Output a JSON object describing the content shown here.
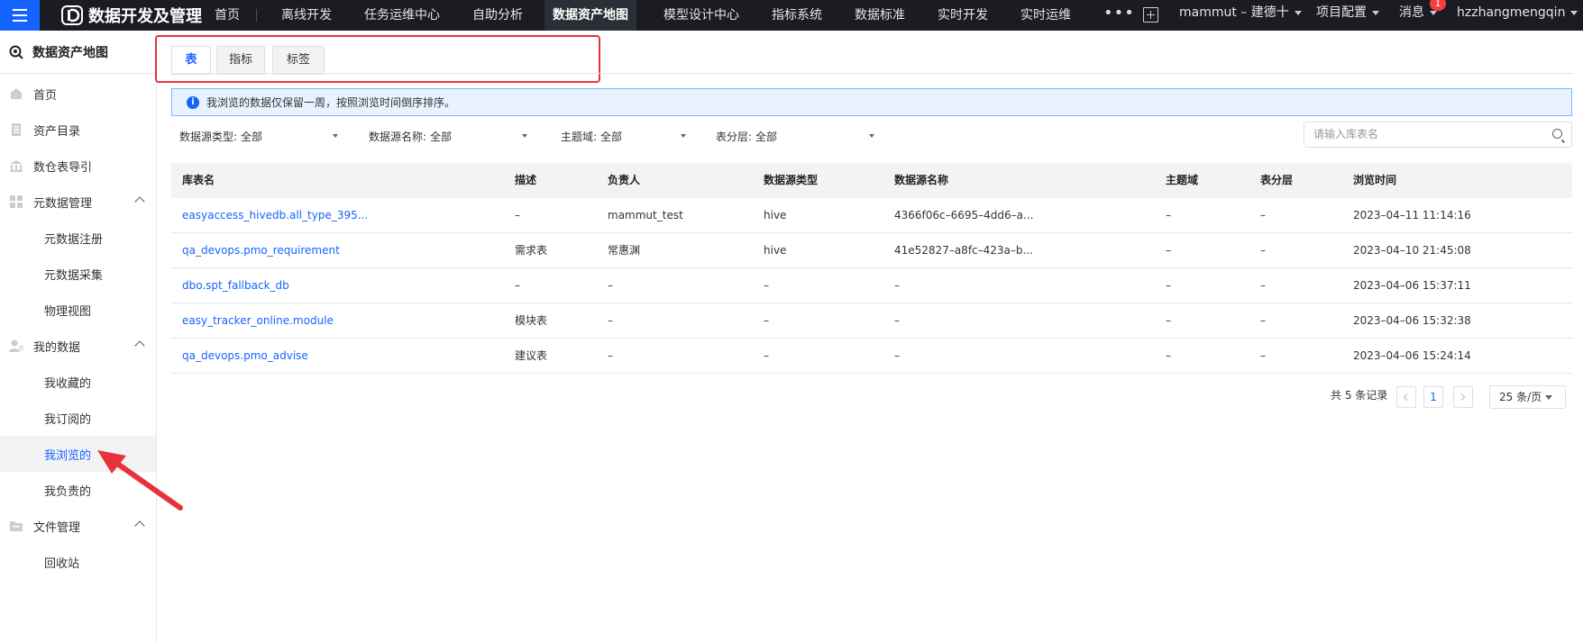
{
  "topbar": {
    "brand": "数据开发及管理",
    "nav": [
      "首页",
      "离线开发",
      "任务运维中心",
      "自助分析",
      "数据资产地图",
      "模型设计中心",
      "指标系统",
      "数据标准",
      "实时开发",
      "实时运维"
    ],
    "more": "•••",
    "project": "mammut – 建德十",
    "config": "项目配置",
    "messages": "消息",
    "message_count": "1",
    "user": "hzzhangmengqin"
  },
  "sidebar": {
    "title": "数据资产地图",
    "items": [
      {
        "label": "首页"
      },
      {
        "label": "资产目录"
      },
      {
        "label": "数仓表导引"
      },
      {
        "label": "元数据管理"
      },
      {
        "label": "元数据注册"
      },
      {
        "label": "元数据采集"
      },
      {
        "label": "物理视图"
      },
      {
        "label": "我的数据"
      },
      {
        "label": "我收藏的"
      },
      {
        "label": "我订阅的"
      },
      {
        "label": "我浏览的"
      },
      {
        "label": "我负责的"
      },
      {
        "label": "文件管理"
      },
      {
        "label": "回收站"
      }
    ]
  },
  "tabs": [
    "表",
    "指标",
    "标签"
  ],
  "info": "我浏览的数据仅保留一周，按照浏览时间倒序排序。",
  "filters": [
    {
      "label": "数据源类型:",
      "value": "全部"
    },
    {
      "label": "数据源名称:",
      "value": "全部"
    },
    {
      "label": "主题域:",
      "value": "全部"
    },
    {
      "label": "表分层:",
      "value": "全部"
    }
  ],
  "search": {
    "placeholder": "请输入库表名"
  },
  "table": {
    "columns": [
      "库表名",
      "描述",
      "负责人",
      "数据源类型",
      "数据源名称",
      "主题域",
      "表分层",
      "浏览时间"
    ],
    "rows": [
      [
        "easyaccess_hivedb.all_type_395...",
        "–",
        "mammut_test",
        "hive",
        "4366f06c–6695–4dd6–a...",
        "–",
        "–",
        "2023–04–11 11:14:16"
      ],
      [
        "qa_devops.pmo_requirement",
        "需求表",
        "常惠渊",
        "hive",
        "41e52827–a8fc–423a–b...",
        "–",
        "–",
        "2023–04–10 21:45:08"
      ],
      [
        "dbo.spt_fallback_db",
        "–",
        "–",
        "–",
        "–",
        "–",
        "–",
        "2023–04–06 15:37:11"
      ],
      [
        "easy_tracker_online.module",
        "模块表",
        "–",
        "–",
        "–",
        "–",
        "–",
        "2023–04–06 15:32:38"
      ],
      [
        "qa_devops.pmo_advise",
        "建议表",
        "–",
        "–",
        "–",
        "–",
        "–",
        "2023–04–06 15:24:14"
      ]
    ]
  },
  "pagination": {
    "total": "共 5 条记录",
    "page": "1",
    "size": "25 条/页"
  },
  "colors": {
    "accent": "#1664ff",
    "topbar": "#1a1c22",
    "highlight": "#e8323a"
  }
}
